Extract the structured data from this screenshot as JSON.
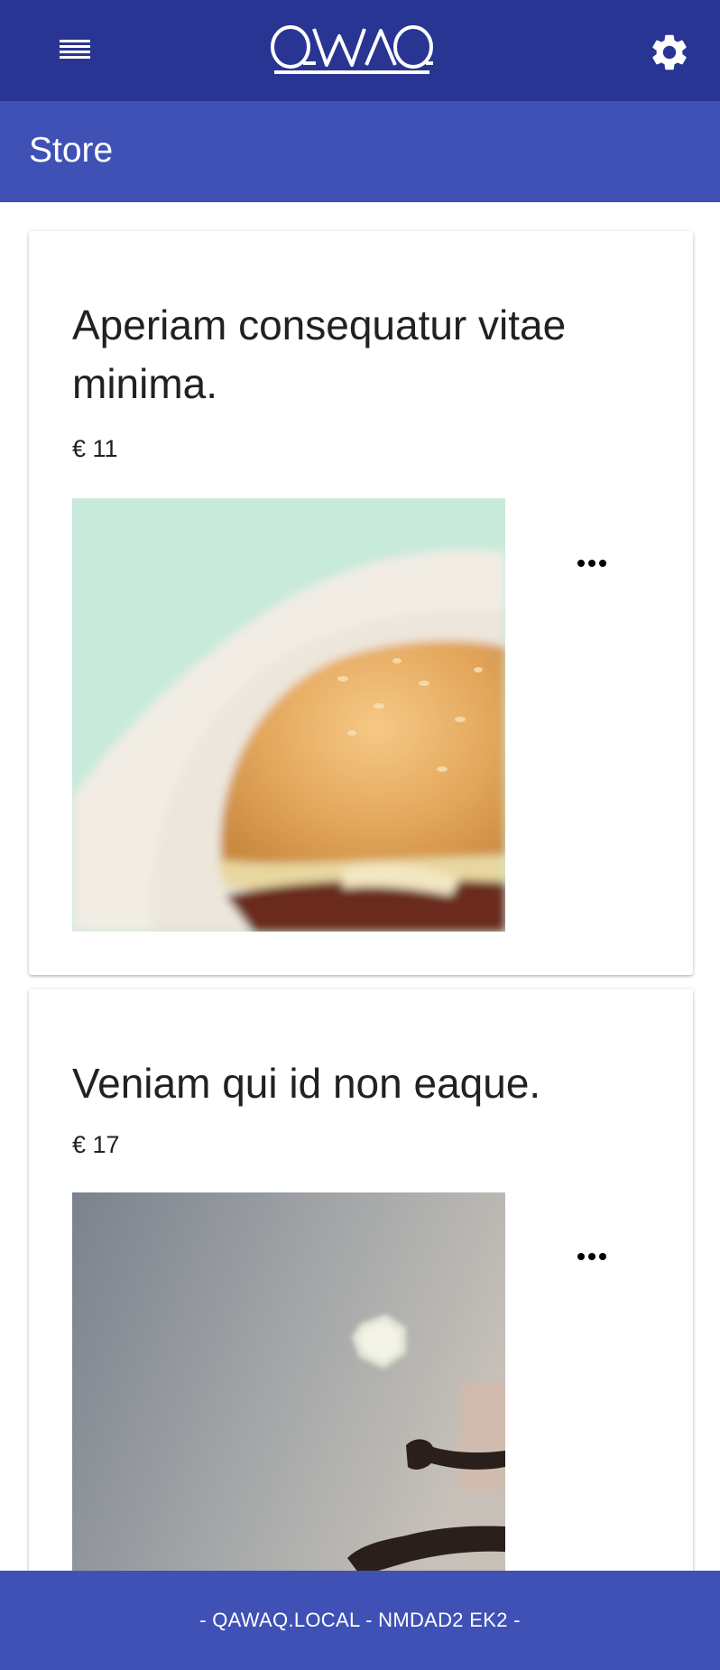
{
  "app": {
    "brand": "QAWAQ",
    "menu_icon": "menu-icon",
    "settings_icon": "gear-icon"
  },
  "header": {
    "title": "Store"
  },
  "products": [
    {
      "title": "Aperiam consequatur vitae minima.",
      "price": "€ 11",
      "image_subject": "burger in paper wrapper",
      "more_icon": "more-horiz-icon"
    },
    {
      "title": "Veniam qui id non eaque.",
      "price": "€ 17",
      "image_subject": "ball in grey sky with silhouetted legs",
      "more_icon": "more-horiz-icon"
    }
  ],
  "footer": {
    "text": "- QAWAQ.LOCAL - NMDAD2 EK2 -"
  },
  "colors": {
    "app_bar": "#283593",
    "sub_bar": "#3f51b5",
    "footer": "#3f51b5",
    "background": "#ffffff"
  }
}
